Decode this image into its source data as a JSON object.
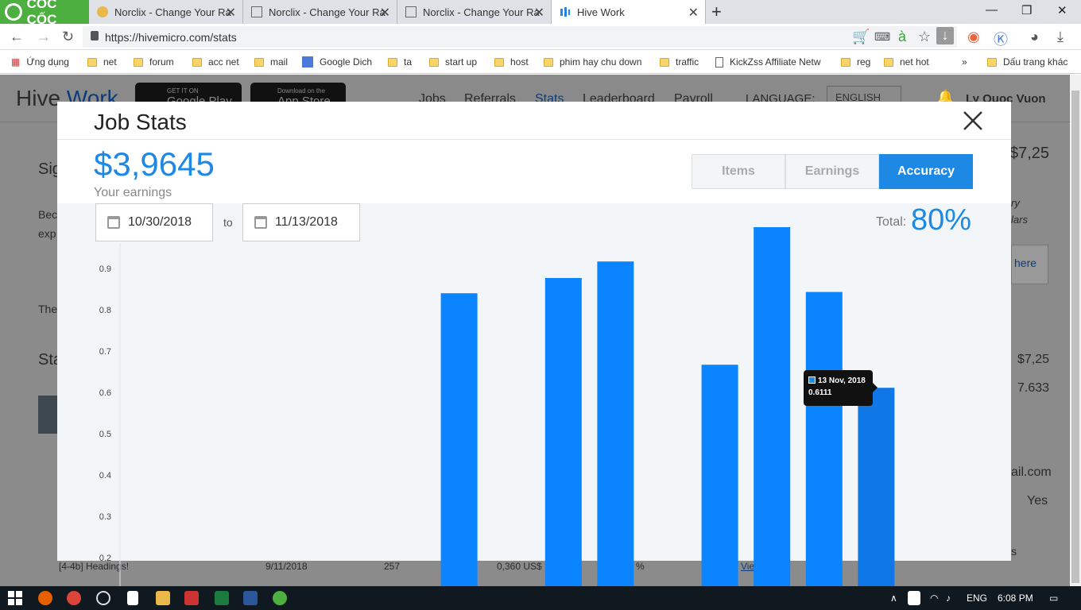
{
  "browser": {
    "brand": "CỐC CỐC",
    "tabs": [
      {
        "title": "Norclix - Change Your Ra",
        "active": false
      },
      {
        "title": "Norclix - Change Your Ra",
        "active": false
      },
      {
        "title": "Norclix - Change Your Ra",
        "active": false
      },
      {
        "title": "Hive Work",
        "active": true
      }
    ],
    "url": "https://hivemicro.com/stats",
    "bookmarks": [
      "Ứng dụng",
      "net",
      "forum",
      "acc net",
      "mail",
      "Google Dich",
      "ta",
      "start up",
      "host",
      "phim hay chu down",
      "traffic",
      "KickZss Affiliate Netw",
      "reg",
      "net hot",
      "Dấu trang khác"
    ]
  },
  "site": {
    "logo_a": "Hive",
    "logo_b": "Work",
    "google_play_small": "GET IT ON",
    "google_play_big": "Google Play",
    "app_store_small": "Download on the",
    "app_store_big": "App Store",
    "nav": [
      "Jobs",
      "Referrals",
      "Stats",
      "Leaderboard",
      "Payroll"
    ],
    "language_label": "LANGUAGE:",
    "language_value": "ENGLISH",
    "user_name": "Ly Quoc Vuon",
    "bg_fragments": {
      "sig": "Sig",
      "bec": "Bec",
      "exp": "exp",
      "the": "The",
      "sta": "Sta",
      "amount_top": "$7,25",
      "ry": "ry",
      "lars": "lars",
      "here": "here",
      "amount_a": "$7,25",
      "amount_b": "7.633",
      "email_frag": "ail.com",
      "yes": "Yes",
      "s": "s",
      "row_name": "[4-4b] Headings!",
      "row_date": "9/11/2018",
      "row_count": "257",
      "row_amount": "0,360 US$",
      "row_pct": "%",
      "row_view": "Vie"
    }
  },
  "modal": {
    "title": "Job Stats",
    "earnings": "$3,9645",
    "earnings_label": "Your earnings",
    "tabs": [
      {
        "label": "Items",
        "active": false
      },
      {
        "label": "Earnings",
        "active": false
      },
      {
        "label": "Accuracy",
        "active": true
      }
    ],
    "date_from": "10/30/2018",
    "date_to_label": "to",
    "date_to": "11/13/2018",
    "total_label": "Total:",
    "total_value": "80%",
    "tooltip": {
      "date": "13 Nov, 2018",
      "value": "0.6111"
    },
    "colors": {
      "accent": "#1e88e5",
      "bar": "#0a84ff",
      "bar_highlight": "#0f78e6"
    }
  },
  "chart_data": {
    "type": "bar",
    "y_ticks": [
      "0.9",
      "0.8",
      "0.7",
      "0.6",
      "0.5",
      "0.4",
      "0.3",
      "0.2"
    ],
    "ylim": [
      0.2,
      0.96
    ],
    "values": [
      null,
      null,
      null,
      null,
      null,
      null,
      0.84,
      null,
      0.877,
      0.917,
      null,
      0.667,
      1.0,
      0.843,
      0.6111
    ],
    "highlight_index": 14
  },
  "taskbar": {
    "language": "ENG",
    "time": "6:08 PM"
  }
}
